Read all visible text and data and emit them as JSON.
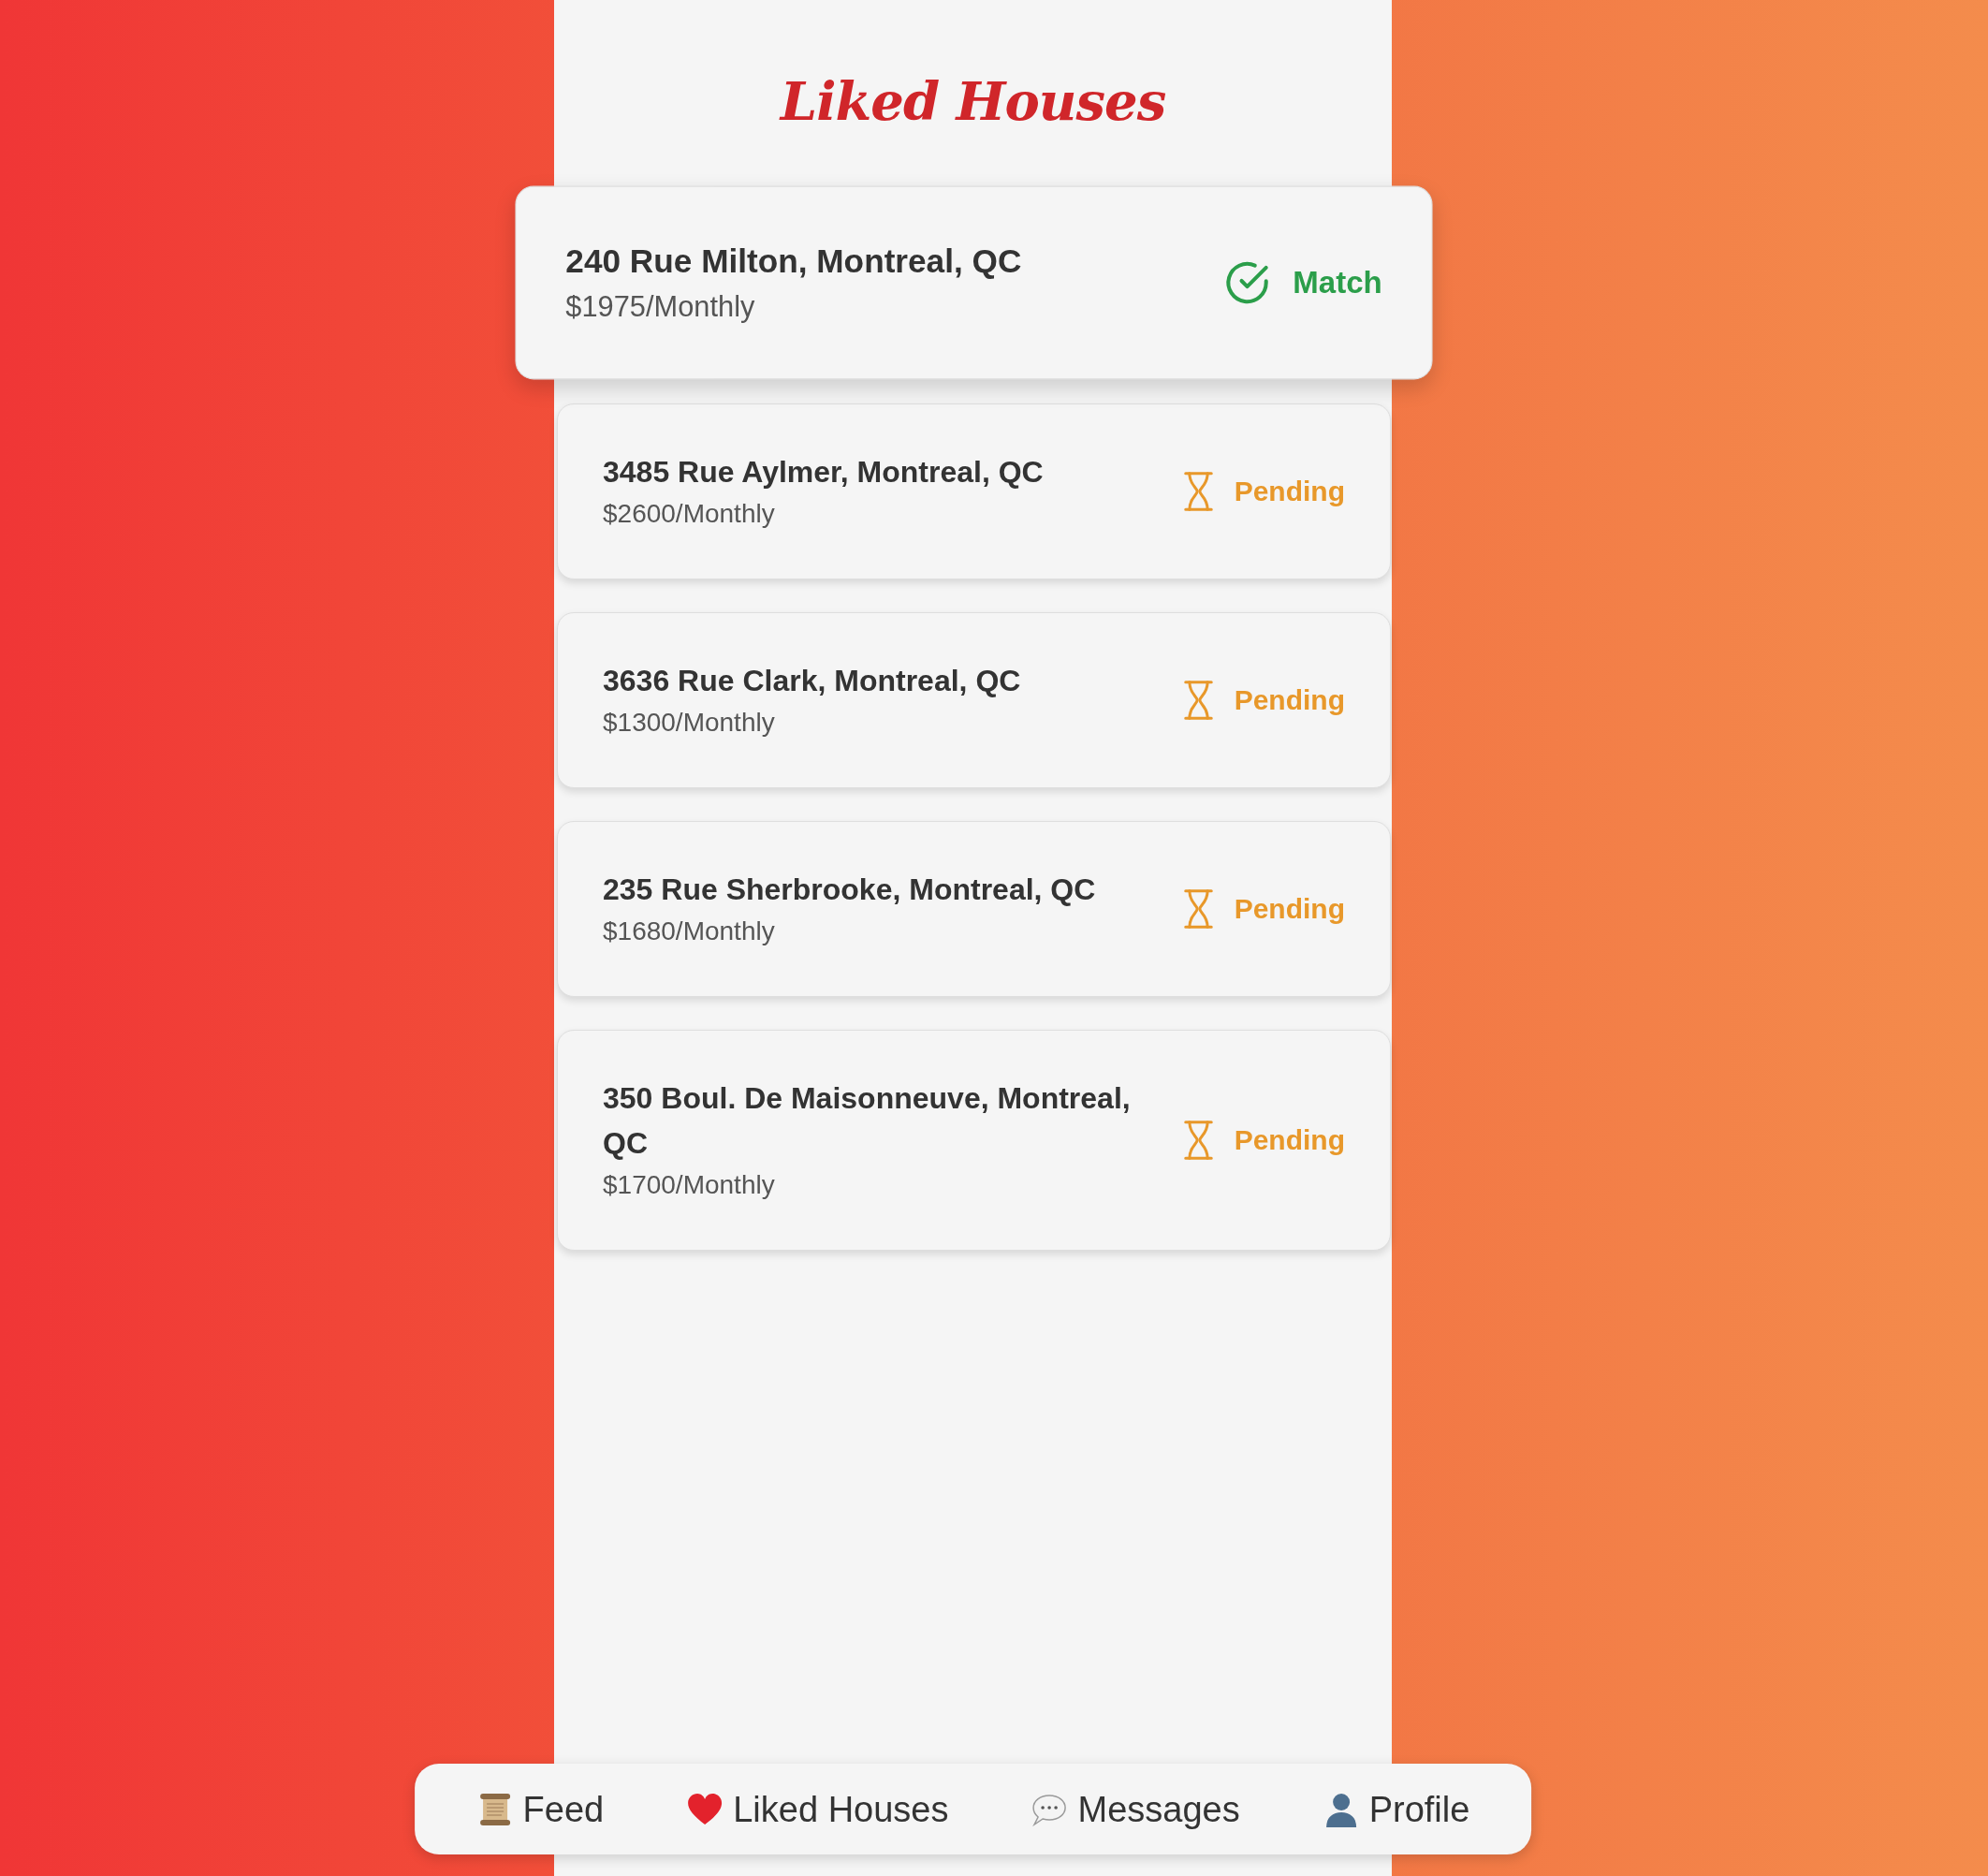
{
  "title": "Liked Houses",
  "houses": [
    {
      "address": "240 Rue Milton, Montreal, QC",
      "price": "$1975/Monthly",
      "highlighted": true,
      "status": {
        "kind": "match",
        "label": "Match"
      }
    },
    {
      "address": "3485 Rue Aylmer, Montreal, QC",
      "price": "$2600/Monthly",
      "highlighted": false,
      "status": {
        "kind": "pending",
        "label": "Pending"
      }
    },
    {
      "address": "3636 Rue Clark, Montreal, QC",
      "price": "$1300/Monthly",
      "highlighted": false,
      "status": {
        "kind": "pending",
        "label": "Pending"
      }
    },
    {
      "address": "235 Rue Sherbrooke, Montreal, QC",
      "price": "$1680/Monthly",
      "highlighted": false,
      "status": {
        "kind": "pending",
        "label": "Pending"
      }
    },
    {
      "address": "350 Boul. De Maisonneuve, Montreal, QC",
      "price": "$1700/Monthly",
      "highlighted": false,
      "status": {
        "kind": "pending",
        "label": "Pending"
      }
    }
  ],
  "nav": [
    {
      "kind": "feed",
      "label": "Feed"
    },
    {
      "kind": "liked",
      "label": "Liked Houses"
    },
    {
      "kind": "messages",
      "label": "Messages"
    },
    {
      "kind": "profile",
      "label": "Profile"
    }
  ]
}
